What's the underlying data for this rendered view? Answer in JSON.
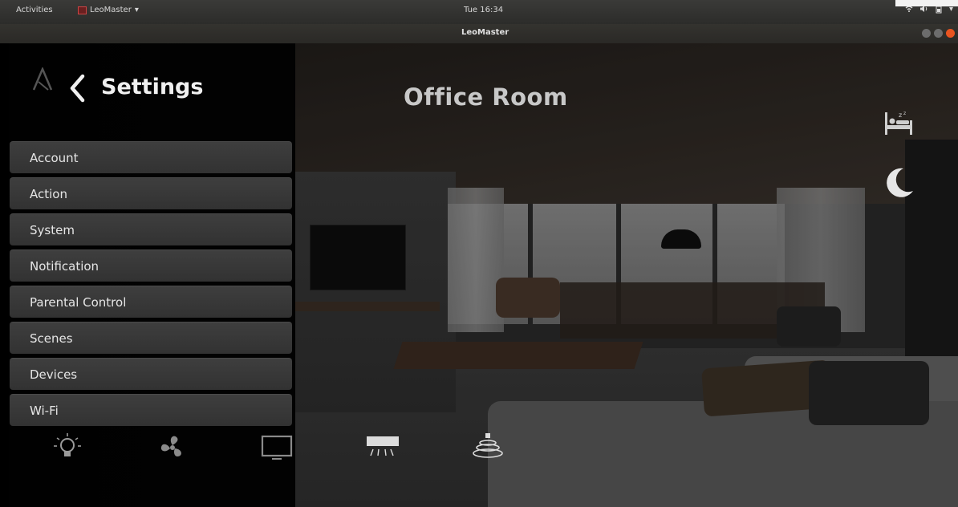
{
  "system_bar": {
    "activities": "Activities",
    "app_name": "LeoMaster",
    "clock": "Tue 16:34"
  },
  "window": {
    "title": "LeoMaster"
  },
  "sidebar": {
    "title": "Settings",
    "items": [
      {
        "label": "Account"
      },
      {
        "label": "Action"
      },
      {
        "label": "System"
      },
      {
        "label": "Notification"
      },
      {
        "label": "Parental Control"
      },
      {
        "label": "Scenes"
      },
      {
        "label": "Devices"
      },
      {
        "label": "Wi-Fi"
      }
    ]
  },
  "room": {
    "name": "Office Room"
  },
  "device_bar": {
    "icons": [
      "light-bulb-icon",
      "fan-icon",
      "tv-icon",
      "air-conditioner-icon",
      "speaker-icon"
    ]
  },
  "colors": {
    "close_button": "#e95420",
    "menu_item_bg": "#3a3a3a",
    "room_title": "#c8c8c8"
  }
}
